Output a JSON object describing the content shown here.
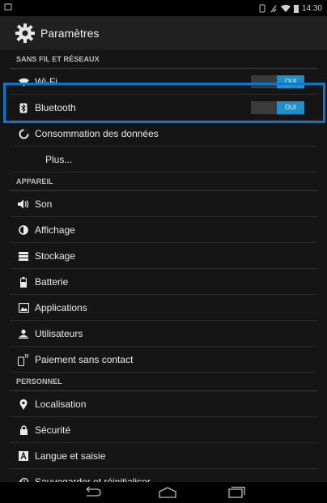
{
  "status": {
    "time": "14:30"
  },
  "header": {
    "title": "Paramètres"
  },
  "sections": [
    {
      "label": "SANS FIL ET RÉSEAUX",
      "items": [
        {
          "label": "Wi-Fi",
          "icon": "wifi-icon",
          "toggle": "OUI"
        },
        {
          "label": "Bluetooth",
          "icon": "bluetooth-icon",
          "toggle": "OUI"
        },
        {
          "label": "Consommation des données",
          "icon": "data-usage-icon"
        },
        {
          "label": "Plus...",
          "icon": ""
        }
      ]
    },
    {
      "label": "APPAREIL",
      "items": [
        {
          "label": "Son",
          "icon": "sound-icon"
        },
        {
          "label": "Affichage",
          "icon": "display-icon"
        },
        {
          "label": "Stockage",
          "icon": "storage-icon"
        },
        {
          "label": "Batterie",
          "icon": "battery-icon"
        },
        {
          "label": "Applications",
          "icon": "apps-icon"
        },
        {
          "label": "Utilisateurs",
          "icon": "users-icon"
        },
        {
          "label": "Paiement sans contact",
          "icon": "nfc-payment-icon"
        }
      ]
    },
    {
      "label": "PERSONNEL",
      "items": [
        {
          "label": "Localisation",
          "icon": "location-icon"
        },
        {
          "label": "Sécurité",
          "icon": "lock-icon"
        },
        {
          "label": "Langue et saisie",
          "icon": "language-icon"
        },
        {
          "label": "Sauvegarder et réinitialiser",
          "icon": "backup-restore-icon"
        }
      ]
    }
  ],
  "colors": {
    "accent": "#1f8fc9",
    "highlight": "#0a78c8"
  }
}
